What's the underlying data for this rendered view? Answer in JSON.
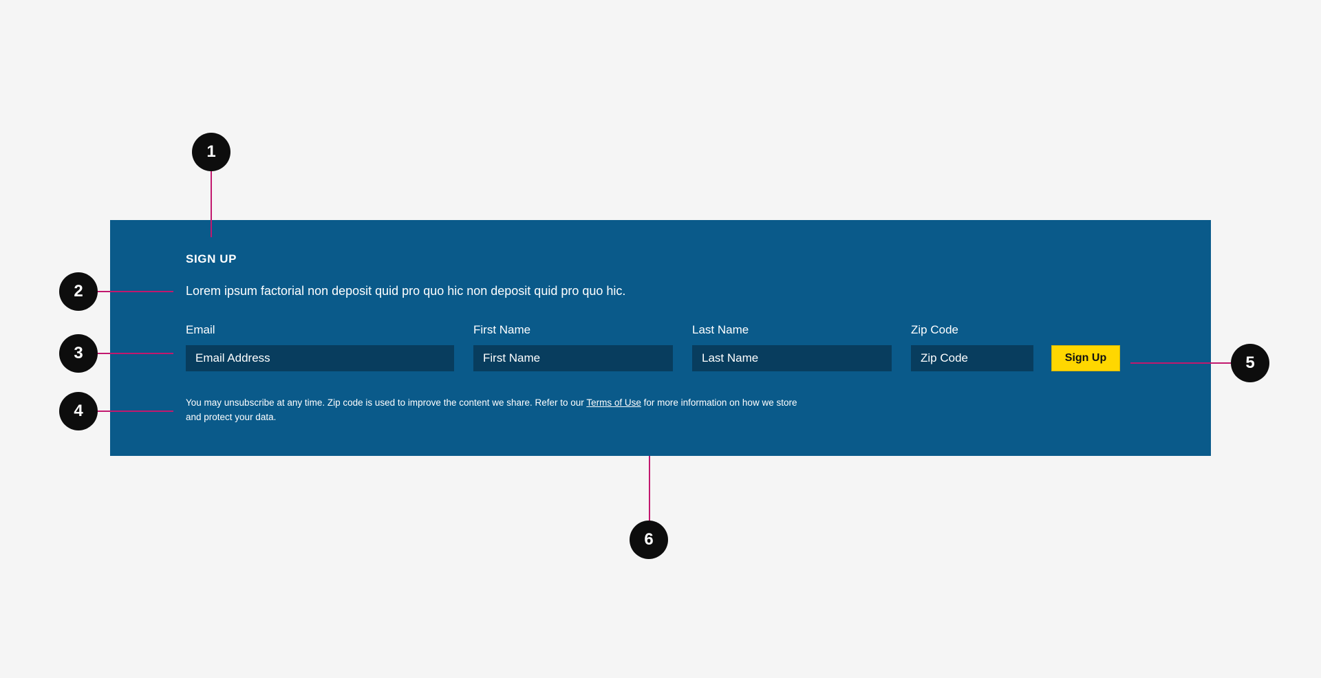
{
  "page": {
    "background_color": "#f5f5f5"
  },
  "signup_panel": {
    "background_color": "#0a5a8a",
    "heading": "SIGN UP",
    "description": "Lorem ipsum factorial non deposit quid pro quo hic non deposit quid pro quo hic.",
    "fields": [
      {
        "name": "email",
        "label": "Email",
        "placeholder": "Email Address",
        "value": ""
      },
      {
        "name": "first_name",
        "label": "First Name",
        "placeholder": "First Name",
        "value": ""
      },
      {
        "name": "last_name",
        "label": "Last Name",
        "placeholder": "Last Name",
        "value": ""
      },
      {
        "name": "zip_code",
        "label": "Zip Code",
        "placeholder": "Zip Code",
        "value": ""
      }
    ],
    "submit_button": {
      "label": "Sign Up",
      "background_color": "#ffd700",
      "text_color": "#111111"
    },
    "input_background_color": "#083d5e",
    "disclaimer": {
      "text_before_link": "You may unsubscribe at any time. Zip code is used to improve the content we share. Refer to our ",
      "link_text": "Terms of Use",
      "text_after_link": " for more information on how we store and protect your data."
    }
  },
  "callouts": {
    "marker_color": "#0d0d0d",
    "leader_color": "#c2186e",
    "items": [
      {
        "number": "1",
        "target": "heading"
      },
      {
        "number": "2",
        "target": "description"
      },
      {
        "number": "3",
        "target": "form-fields"
      },
      {
        "number": "4",
        "target": "disclaimer"
      },
      {
        "number": "5",
        "target": "submit-button"
      },
      {
        "number": "6",
        "target": "panel-container"
      }
    ]
  }
}
